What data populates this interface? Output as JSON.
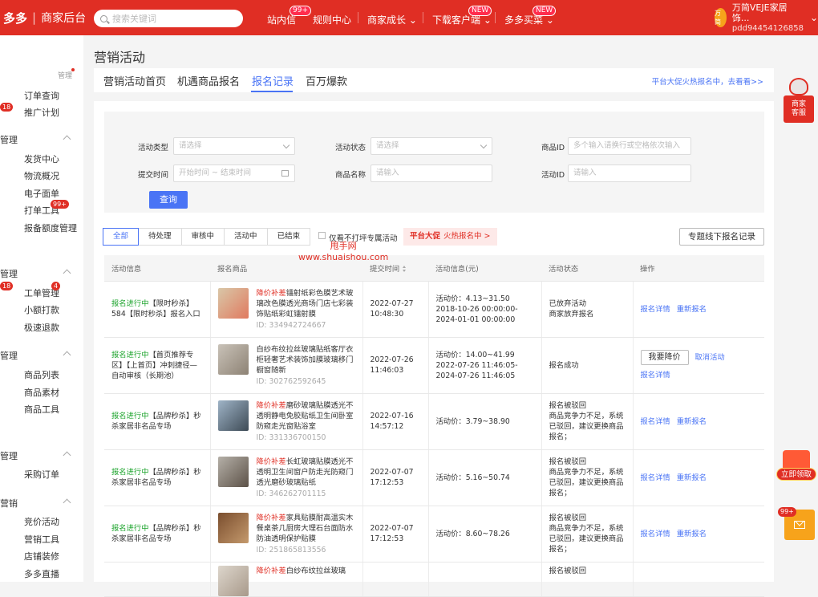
{
  "colors": {
    "brand": "#e02e24",
    "accent": "#4a74f5",
    "status_green": "#1aa32a"
  },
  "header": {
    "logo_brand": "多多",
    "logo_sep": "|",
    "logo_title": "商家后台",
    "search_placeholder": "搜索关键词",
    "nav": {
      "inbox": "站内信",
      "inbox_badge": "99+",
      "rules": "规则中心",
      "growth": "商家成长",
      "download": "下载客户端",
      "download_badge": "NEW",
      "buyer": "多多买菜",
      "buyer_badge": "NEW"
    },
    "user": {
      "avatar_text": "万简",
      "name": "万简VEJE家居饰...",
      "id": "pdd94454126858"
    }
  },
  "sidebar": {
    "manage_label": "管理",
    "sections": [
      {
        "title": "",
        "items": [
          "订单查询",
          "推广计划"
        ]
      },
      {
        "title": "管理",
        "items": [
          "发货中心",
          "物流概况",
          "电子面单",
          "打单工具",
          "报备额度管理"
        ]
      },
      {
        "title": "管理",
        "items": [
          "工单管理",
          "小额打款",
          "极速退款"
        ]
      },
      {
        "title": "管理",
        "items": [
          "商品列表",
          "商品素材",
          "商品工具"
        ]
      },
      {
        "title": "管理",
        "items": [
          "采购订单"
        ]
      },
      {
        "title": "营销",
        "items": [
          "竞价活动",
          "营销工具",
          "店铺装修",
          "多多直播"
        ]
      }
    ],
    "badges": {
      "b1": "18",
      "b2": "99+",
      "b3": "18",
      "b4": "4"
    }
  },
  "page": {
    "title": "营销活动",
    "tabs": [
      "营销活动首页",
      "机遇商品报名",
      "报名记录",
      "百万爆款"
    ],
    "promo_link": "平台大促火热报名中，去看看>>"
  },
  "filters": {
    "activity_type": {
      "label": "活动类型",
      "placeholder": "请选择"
    },
    "activity_status": {
      "label": "活动状态",
      "placeholder": "请选择"
    },
    "product_id": {
      "label": "商品ID",
      "placeholder": "多个输入请换行或空格依次输入"
    },
    "submit_time": {
      "label": "提交时间",
      "start": "开始时间",
      "tilde": "~",
      "end": "结束时间"
    },
    "product_name": {
      "label": "商品名称",
      "placeholder": "请输入"
    },
    "activity_id": {
      "label": "活动ID",
      "placeholder": "请输入"
    },
    "query_button": "查询"
  },
  "status_tabs": [
    "全部",
    "待处理",
    "审核中",
    "活动中",
    "已结束"
  ],
  "only_unmarked": "仅看不打坪专属活动",
  "hot_badge": {
    "strong": "平台大促",
    "text": "火热报名中 >"
  },
  "offline_button": "专题线下报名记录",
  "table": {
    "headers": [
      "活动信息",
      "报名商品",
      "提交时间",
      "活动信息(元)",
      "活动状态",
      "操作"
    ],
    "rows": [
      {
        "status": "报名进行中",
        "activity": "【限时秒杀】584【限时秒杀】报名入口",
        "tag": "降价补差",
        "product": "镭射纸彩色膜艺术玻璃改色膜透光商场门店七彩装饰贴纸彩虹镭射膜",
        "pid": "ID: 334942724667",
        "date": "2022-07-27",
        "time": "10:48:30",
        "price": "活动价：4.13~31.50",
        "period": "2018-10-26 00:00:00-2024-01-01 00:00:00",
        "state": "已放弃活动",
        "state2": "商家放弃报名",
        "state3": "",
        "state4": "",
        "op1": "报名详情",
        "op2": "重新报名",
        "opbtn": ""
      },
      {
        "status": "报名进行中",
        "activity": "【首页推荐专区】【上首页】冲刺捷径—自动审核（长期池）",
        "tag": "",
        "product": "白纱布纹拉丝玻璃贴纸客厅衣柜轻奢艺术装饰加膜玻璃移门橱窗随新",
        "pid": "ID: 302762592645",
        "date": "2022-07-26",
        "time": "11:46:03",
        "price": "活动价：14.00~41.99",
        "period": "2022-07-26 11:46:05-2024-07-26 11:46:05",
        "state": "报名成功",
        "state2": "",
        "state3": "",
        "state4": "",
        "op1": "报名详情",
        "op2": "取消活动",
        "opbtn": "我要降价"
      },
      {
        "status": "报名进行中",
        "activity": "【品牌秒杀】秒杀家居非名品专场",
        "tag": "降价补差",
        "product": "磨砂玻璃贴膜透光不透明静电免胶贴纸卫生间卧室防窥走光窗贴浴室",
        "pid": "ID: 331336700150",
        "date": "2022-07-16",
        "time": "14:57:12",
        "price": "活动价：3.79~38.90",
        "period": "",
        "state": "报名被驳回",
        "state2": "商品竞争力不足，系统",
        "state3": "已驳回，建议更换商品",
        "state4": "报名；",
        "op1": "报名详情",
        "op2": "重新报名",
        "opbtn": ""
      },
      {
        "status": "报名进行中",
        "activity": "【品牌秒杀】秒杀家居非名品专场",
        "tag": "降价补差",
        "product": "长虹玻璃贴膜透光不透明卫生间窗户防走光防窥门透光磨砂玻璃贴纸",
        "pid": "ID: 346262701115",
        "date": "2022-07-07",
        "time": "17:12:53",
        "price": "活动价：5.16~50.74",
        "period": "",
        "state": "报名被驳回",
        "state2": "商品竞争力不足，系统",
        "state3": "已驳回，建议更换商品",
        "state4": "报名；",
        "op1": "报名详情",
        "op2": "重新报名",
        "opbtn": ""
      },
      {
        "status": "报名进行中",
        "activity": "【品牌秒杀】秒杀家居非名品专场",
        "tag": "降价补差",
        "product": "家具贴膜耐高温实木餐桌茶几厨房大理石台面防水防油透明保护贴膜",
        "pid": "ID: 251865813556",
        "date": "2022-07-07",
        "time": "17:12:53",
        "price": "活动价：8.60~78.26",
        "period": "",
        "state": "报名被驳回",
        "state2": "商品竞争力不足，系统",
        "state3": "已驳回，建议更换商品",
        "state4": "报名；",
        "op1": "报名详情",
        "op2": "重新报名",
        "opbtn": ""
      },
      {
        "status": "",
        "activity": "",
        "tag": "降价补差",
        "product": "白纱布纹拉丝玻璃",
        "pid": "",
        "date": "",
        "time": "",
        "price": "",
        "period": "",
        "state": "报名被驳回",
        "state2": "",
        "state3": "",
        "state4": "",
        "op1": "",
        "op2": "",
        "opbtn": ""
      }
    ]
  },
  "watermark": {
    "line1": "甩手网",
    "line2": "www.shuaishou.com"
  },
  "right_float": {
    "service_line1": "商家",
    "service_line2": "客服",
    "redpacket_label": "立即领取",
    "mail_badge": "99+"
  }
}
